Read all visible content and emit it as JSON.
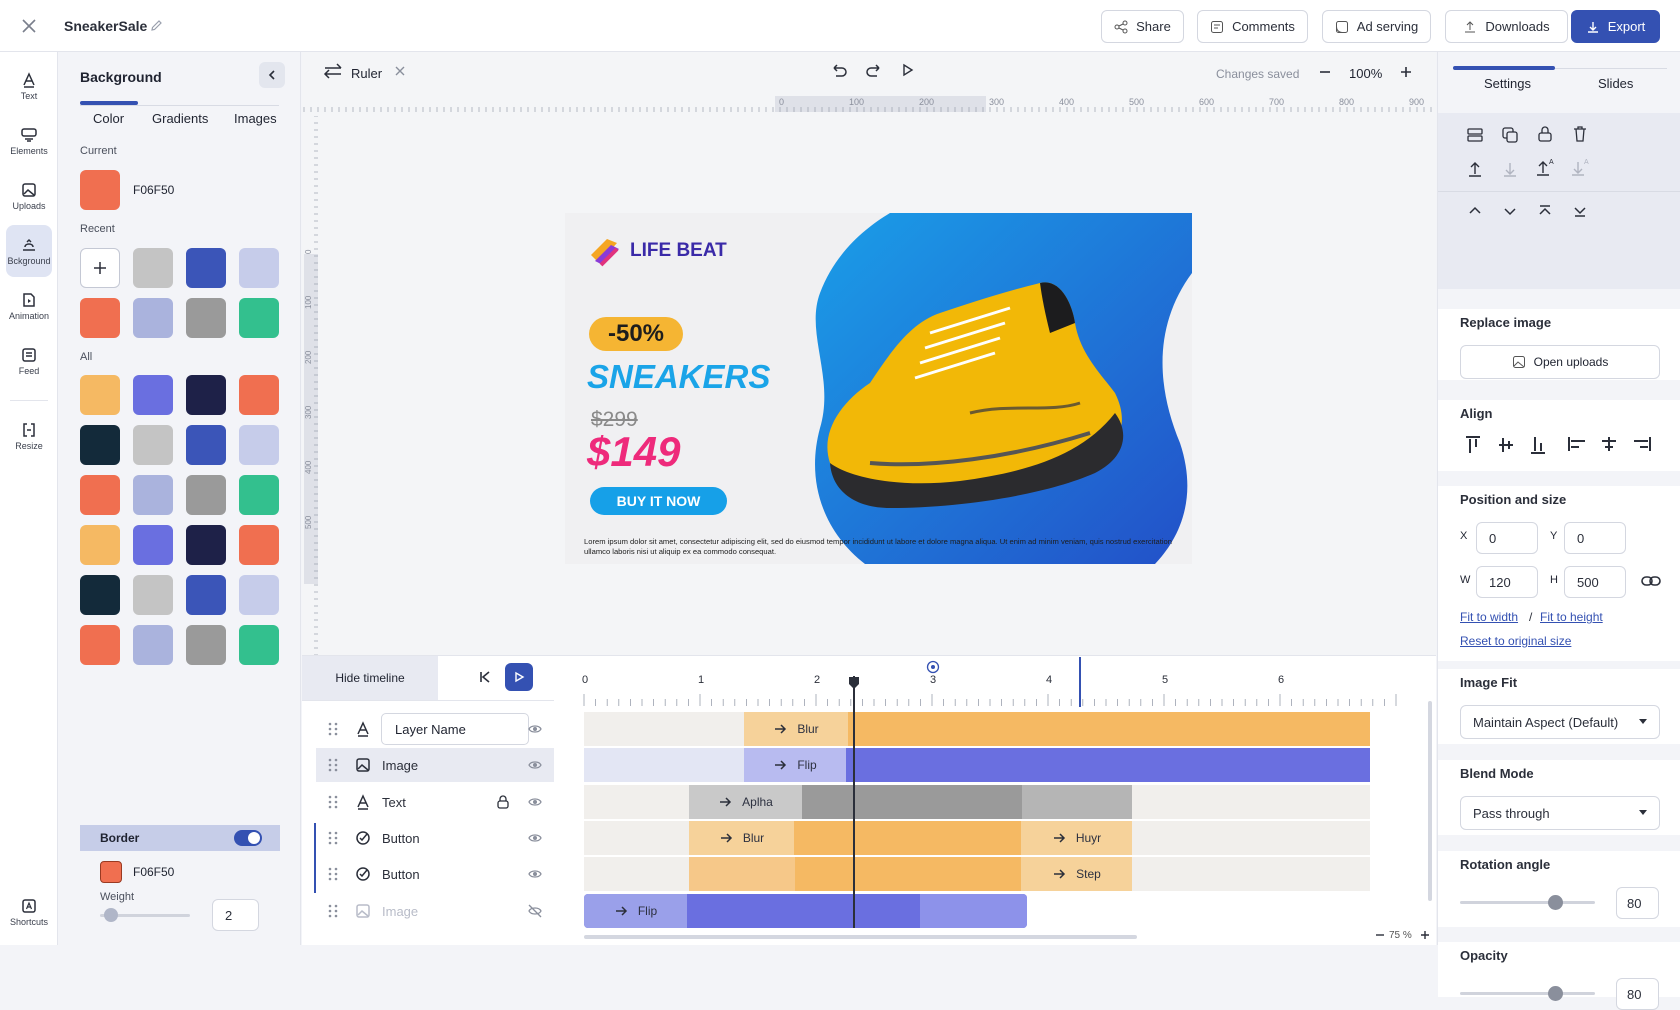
{
  "topbar": {
    "title": "SneakerSale",
    "share": "Share",
    "comments": "Comments",
    "ad_serving": "Ad serving",
    "downloads": "Downloads",
    "export": "Export"
  },
  "rail": {
    "text": "Text",
    "elements": "Elements",
    "uploads": "Uploads",
    "background": "Bckground",
    "animation": "Animation",
    "feed": "Feed",
    "resize": "Resize",
    "shortcuts": "Shortcuts"
  },
  "bgpanel": {
    "title": "Background",
    "tabs": [
      "Color",
      "Gradients",
      "Images"
    ],
    "current_label": "Current",
    "current_hex": "F06F50",
    "current_color": "#F06F50",
    "recent_label": "Recent",
    "recent_colors": [
      "#C4C4C4",
      "#3B55B8",
      "#C6CCEA",
      "#F06F50",
      "#AAB3DD",
      "#9A9A9A",
      "#33C08E"
    ],
    "all_label": "All",
    "all_colors": [
      "#F5B963",
      "#6A6FE0",
      "#1E2148",
      "#F06F50",
      "#132A3A",
      "#C4C4C4",
      "#3B55B8",
      "#C6CCEA",
      "#F06F50",
      "#AAB3DD",
      "#9A9A9A",
      "#33C08E",
      "#F5B963",
      "#6A6FE0",
      "#1E2148",
      "#F06F50",
      "#132A3A",
      "#C4C4C4",
      "#3B55B8",
      "#C6CCEA",
      "#F06F50",
      "#AAB3DD",
      "#9A9A9A",
      "#33C08E"
    ],
    "border_label": "Border",
    "border_hex": "F06F50",
    "weight_label": "Weight",
    "weight_value": "2"
  },
  "canvas": {
    "ruler_label": "Ruler",
    "changes_saved": "Changes saved",
    "zoom": "100%",
    "ruler_ticks": [
      "0",
      "100",
      "200",
      "300",
      "400",
      "500",
      "600",
      "700",
      "800",
      "900"
    ],
    "vruler_ticks": [
      "0",
      "100",
      "200",
      "300",
      "400",
      "500"
    ]
  },
  "ad": {
    "brand": "LIFE BEAT",
    "discount": "-50%",
    "headline": "SNEAKERS",
    "old_price": "$299",
    "new_price": "$149",
    "cta": "BUY IT NOW",
    "disclaimer": "Lorem ipsum dolor sit amet, consectetur adipiscing elit, sed do eiusmod tempor incididunt ut labore et dolore magna aliqua. Ut enim ad minim veniam, quis nostrud exercitation ullamco laboris nisi ut aliquip ex ea commodo consequat."
  },
  "timeline": {
    "hide_label": "Hide timeline",
    "ticks": [
      "0",
      "1",
      "2",
      "3",
      "4",
      "5",
      "6"
    ],
    "zoom": "75 %",
    "layers": [
      {
        "name": "Layer Name"
      },
      {
        "name": "Image"
      },
      {
        "name": "Text"
      },
      {
        "name": "Button"
      },
      {
        "name": "Button"
      },
      {
        "name": "Image"
      }
    ],
    "chips": {
      "r0": "Blur",
      "r1": "Flip",
      "r2": "Aplha",
      "r3a": "Blur",
      "r3b": "Huyr",
      "r4": "Step",
      "r5": "Flip"
    }
  },
  "rpanel": {
    "tabs": [
      "Settings",
      "Slides"
    ],
    "replace_image": "Replace image",
    "open_uploads": "Open uploads",
    "align": "Align",
    "position_size": "Position and size",
    "x_label": "X",
    "x": "0",
    "y_label": "Y",
    "y": "0",
    "w_label": "W",
    "w": "120",
    "h_label": "H",
    "h": "500",
    "fit_width": "Fit to width",
    "slash": "/",
    "fit_height": "Fit to height",
    "reset": "Reset to original size",
    "image_fit": "Image Fit",
    "image_fit_value": "Maintain Aspect (Default)",
    "blend_mode": "Blend Mode",
    "blend_value": "Pass through",
    "rotation": "Rotation angle",
    "rotation_value": "80",
    "opacity": "Opacity",
    "opacity_value": "80"
  }
}
